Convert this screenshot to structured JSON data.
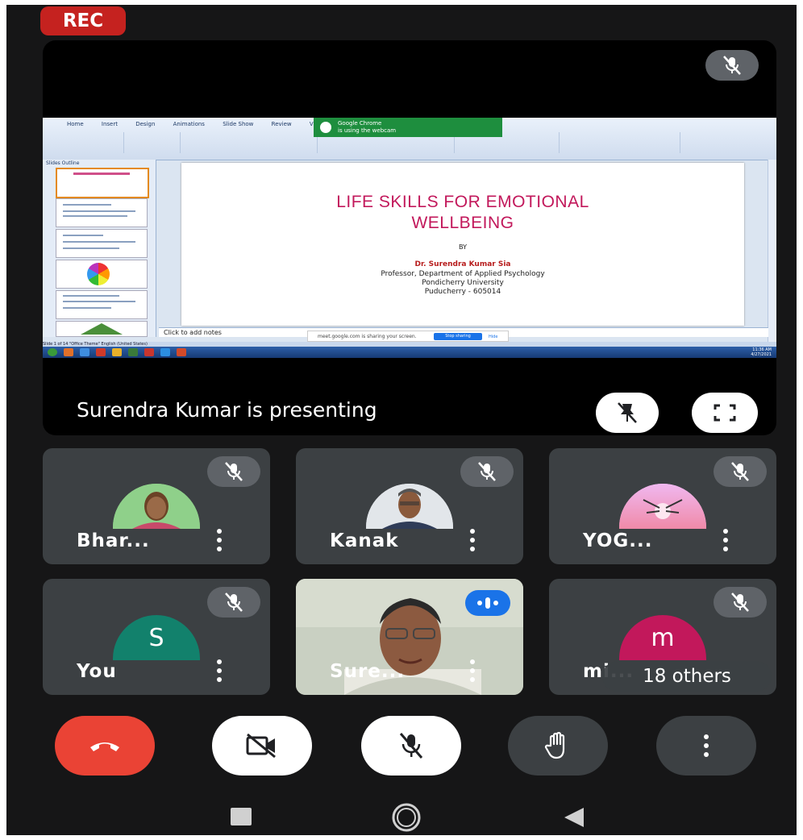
{
  "recording": {
    "label": "REC",
    "color": "#c5221f"
  },
  "presentation": {
    "presenting_text": "Surendra Kumar is presenting",
    "mute_icon": "mic-off-icon",
    "pin_icon": "pin-off-icon",
    "fullscreen_icon": "fullscreen-icon",
    "ribbon_tabs": [
      "Home",
      "Insert",
      "Design",
      "Animations",
      "Slide Show",
      "Review",
      "View"
    ],
    "chrome_notification": {
      "line1": "Google Chrome",
      "line2": "is using the webcam"
    },
    "thumbnail_tabs": "Slides   Outline",
    "slide": {
      "title_line1": "LIFE SKILLS FOR EMOTIONAL",
      "title_line2": "WELLBEING",
      "by": "BY",
      "author": "Dr. Surendra Kumar Sia",
      "line1": "Professor, Department of Applied Psychology",
      "line2": "Pondicherry University",
      "line3": "Puducherry - 605014"
    },
    "notes_placeholder": "Click to add notes",
    "share_bar": {
      "text": "meet.google.com is sharing your screen.",
      "stop": "Stop sharing",
      "hide": "Hide"
    },
    "status_bar": "Slide 1 of 14    \"Office Theme\"    English (United States)",
    "clock": {
      "time": "11:36 AM",
      "date": "4/27/2021"
    }
  },
  "participants": [
    {
      "name": "Bhar...",
      "muted": true,
      "avatar_type": "photo-woman"
    },
    {
      "name": "Kanak",
      "muted": true,
      "avatar_type": "photo-man"
    },
    {
      "name": "YOG...",
      "muted": true,
      "avatar_type": "photo-sunset"
    },
    {
      "name": "You",
      "muted": true,
      "avatar_letter": "S",
      "avatar_color": "#12816c"
    },
    {
      "name": "Sure...",
      "muted": false,
      "speaking": true,
      "avatar_type": "video"
    },
    {
      "name": "mi...",
      "muted": true,
      "avatar_letter": "m",
      "avatar_color": "#c2185b",
      "overlay": "18 others"
    }
  ],
  "controls": {
    "end_call_icon": "end-call-icon",
    "camera_icon": "camera-off-icon",
    "mic_icon": "mic-off-icon",
    "raise_hand_icon": "raise-hand-icon",
    "more_icon": "more-options-icon",
    "end_call_color": "#ea4335"
  },
  "navbar": {
    "recents_icon": "recents-icon",
    "home_icon": "home-icon",
    "back_icon": "back-icon"
  }
}
